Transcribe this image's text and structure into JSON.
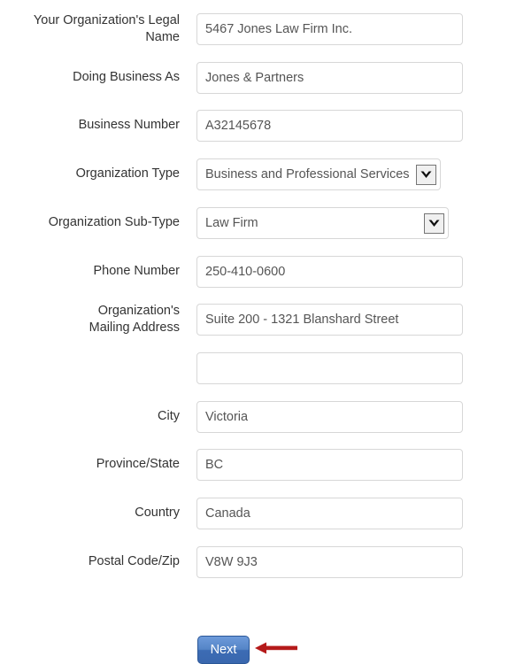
{
  "form": {
    "rows": [
      {
        "name": "legal-name",
        "label": "Your Organization's Legal\nName",
        "label_lines": 2,
        "control": "text",
        "value": "5467 Jones Law Firm Inc.",
        "placeholder": ""
      },
      {
        "name": "doing-business-as",
        "label": "Doing Business As",
        "label_lines": 1,
        "control": "text",
        "value": "Jones & Partners",
        "placeholder": ""
      },
      {
        "name": "business-number",
        "label": "Business Number",
        "label_lines": 1,
        "control": "text",
        "value": "A32145678",
        "placeholder": ""
      },
      {
        "name": "organization-type",
        "label": "Organization Type",
        "label_lines": 1,
        "control": "select",
        "value": "Business and Professional Services",
        "placeholder": ""
      },
      {
        "name": "organization-sub-type",
        "label": "Organization Sub-Type",
        "label_lines": 1,
        "control": "select-wide",
        "value": "Law Firm",
        "placeholder": ""
      },
      {
        "name": "phone-number",
        "label": "Phone Number",
        "label_lines": 1,
        "control": "text",
        "value": "250-410-0600",
        "placeholder": ""
      },
      {
        "name": "mailing-address-line-1",
        "label": "Organization's\nMailing Address",
        "label_lines": 2,
        "control": "text",
        "value": "Suite 200 - 1321 Blanshard Street",
        "placeholder": ""
      },
      {
        "name": "mailing-address-line-2",
        "label": "",
        "label_lines": 0,
        "control": "text",
        "value": "",
        "placeholder": ""
      },
      {
        "name": "city",
        "label": "City",
        "label_lines": 1,
        "control": "text",
        "value": "Victoria",
        "placeholder": ""
      },
      {
        "name": "province-state",
        "label": "Province/State",
        "label_lines": 1,
        "control": "text",
        "value": "BC",
        "placeholder": ""
      },
      {
        "name": "country",
        "label": "Country",
        "label_lines": 1,
        "control": "text",
        "value": "Canada",
        "placeholder": ""
      },
      {
        "name": "postal-code-zip",
        "label": "Postal Code/Zip",
        "label_lines": 1,
        "control": "text",
        "value": "V8W 9J3",
        "placeholder": ""
      }
    ],
    "submit_label": "Next"
  },
  "annotation": {
    "arrow_icon": "left-arrow-icon",
    "arrow_color": "#b51a1a"
  },
  "icons": {
    "select_chevron": "chevron-down-icon"
  },
  "colors": {
    "page_background": "#ffffff",
    "input_border": "#d7d7d7",
    "input_text": "#555555",
    "label_text": "#333333",
    "button_background": "#4a7ac0",
    "button_border": "#2b5797",
    "button_text": "#ffffff",
    "annotation_red": "#b51a1a"
  }
}
